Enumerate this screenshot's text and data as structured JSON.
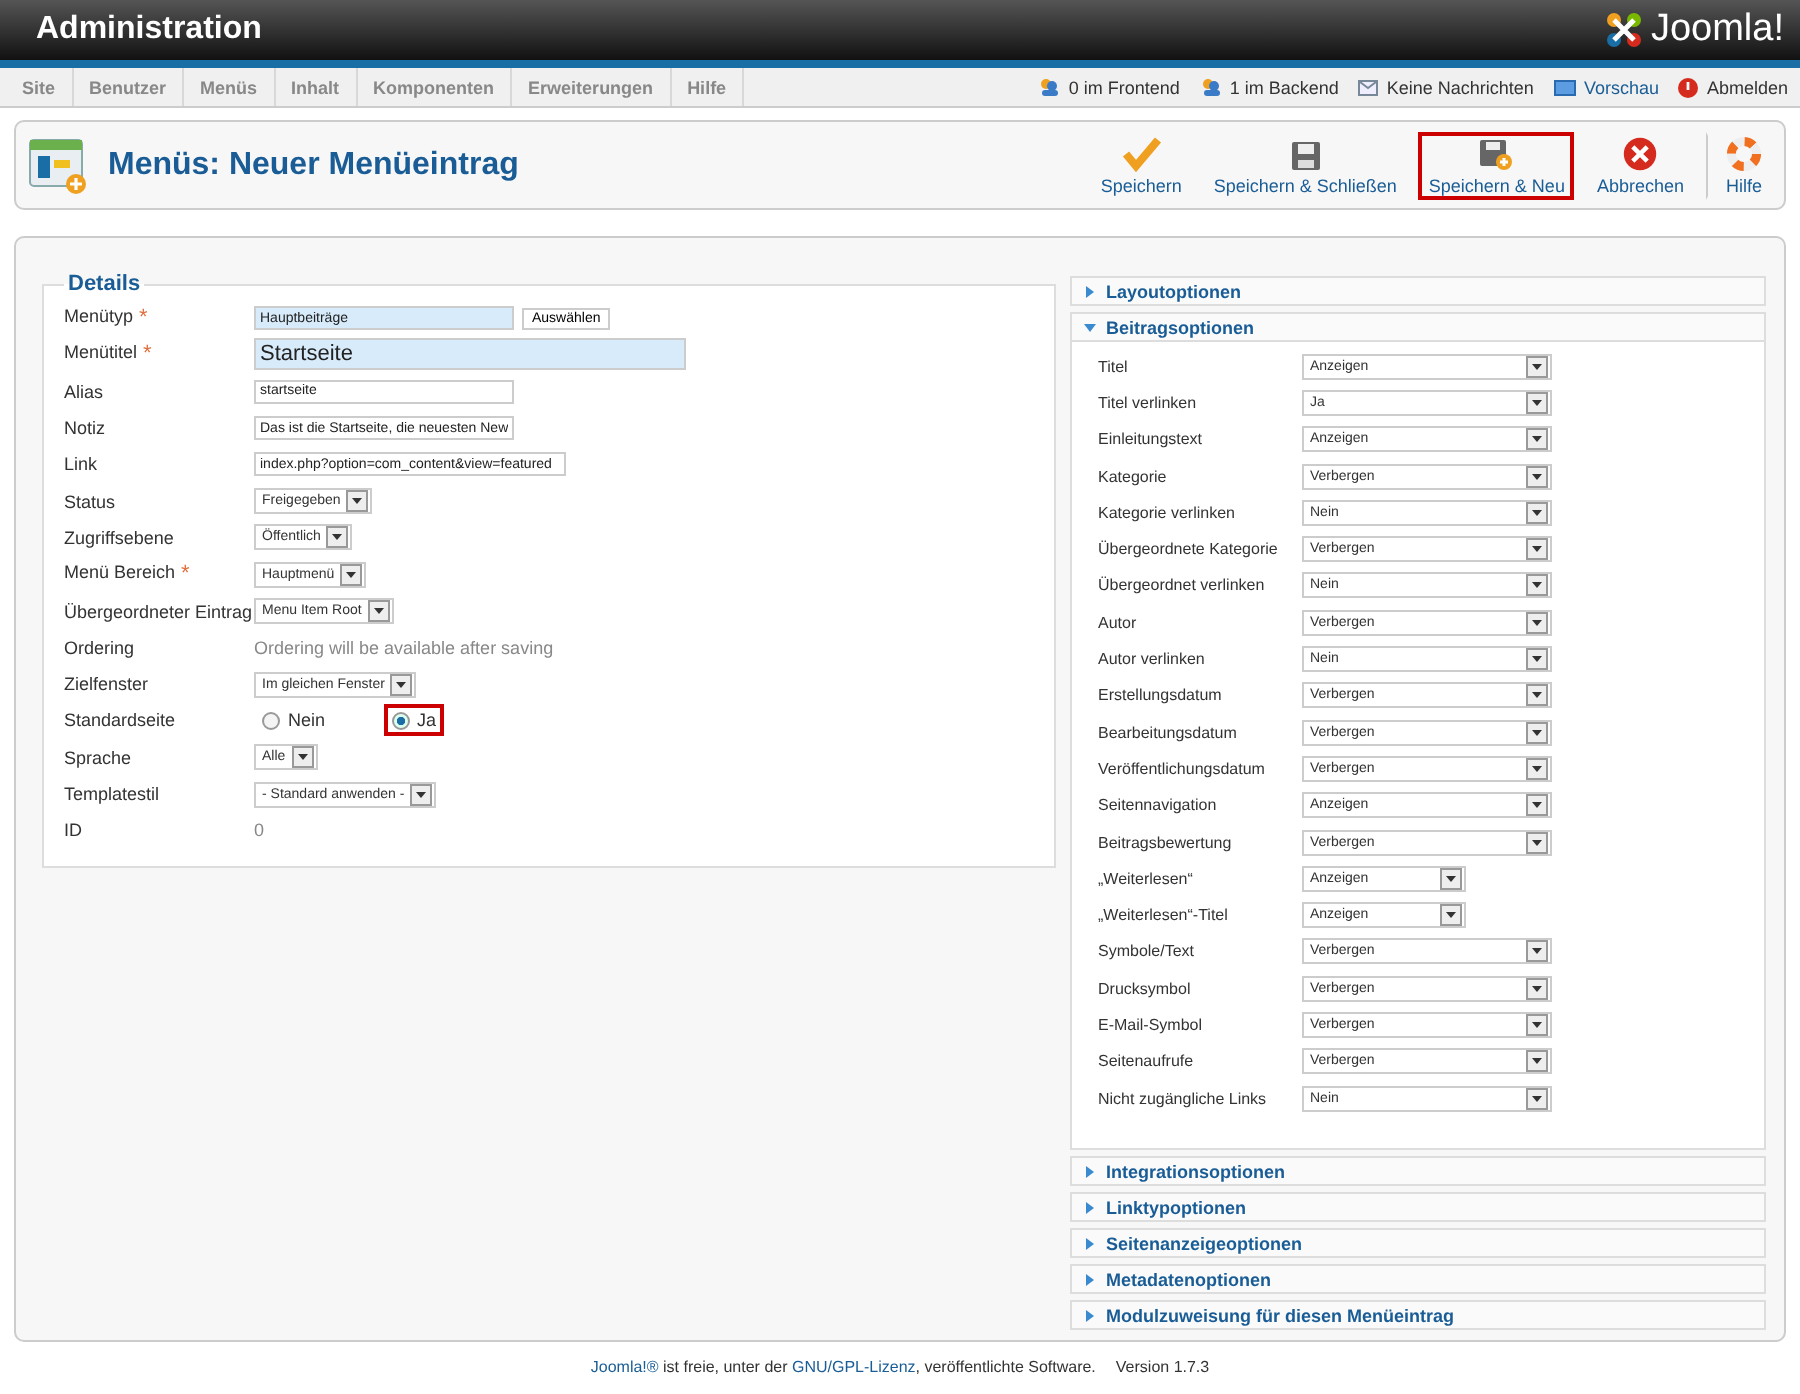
{
  "header": {
    "title": "Administration",
    "logo": "Joomla!"
  },
  "menu": [
    {
      "label": "Site"
    },
    {
      "label": "Benutzer"
    },
    {
      "label": "Menüs"
    },
    {
      "label": "Inhalt"
    },
    {
      "label": "Komponenten"
    },
    {
      "label": "Erweiterungen"
    },
    {
      "label": "Hilfe"
    }
  ],
  "status": [
    {
      "kind": "users",
      "label": "0 im Frontend"
    },
    {
      "kind": "users",
      "label": "1 im Backend"
    },
    {
      "kind": "mail",
      "label": "Keine Nachrichten"
    },
    {
      "kind": "preview",
      "label": "Vorschau"
    },
    {
      "kind": "logout",
      "label": "Abmelden"
    }
  ],
  "page_title": "Menüs: Neuer Menüeintrag",
  "toolbar": [
    {
      "kind": "save",
      "label": "Speichern",
      "highlighted": false
    },
    {
      "kind": "save-close",
      "label": "Speichern & Schließen",
      "highlighted": false
    },
    {
      "kind": "save-new",
      "label": "Speichern & Neu",
      "highlighted": true
    },
    {
      "kind": "cancel",
      "label": "Abbrechen",
      "highlighted": false
    },
    {
      "kind": "help",
      "label": "Hilfe",
      "highlighted": false
    }
  ],
  "details": {
    "legend": "Details",
    "fields": [
      {
        "kind": "picker",
        "label": "Menütyp",
        "required_mark": "*",
        "value": "Hauptbeiträge",
        "button": "Auswählen"
      },
      {
        "kind": "title",
        "label": "Menütitel",
        "required_mark": "*",
        "value": "Startseite"
      },
      {
        "kind": "text",
        "label": "Alias",
        "value": "startseite"
      },
      {
        "kind": "text",
        "label": "Notiz",
        "value": "Das ist die Startseite, die neuesten New"
      },
      {
        "kind": "text",
        "label": "Link",
        "value": "index.php?option=com_content&view=featured"
      },
      {
        "kind": "select",
        "label": "Status",
        "value": "Freigegeben"
      },
      {
        "kind": "select",
        "label": "Zugriffsebene",
        "value": "Öffentlich"
      },
      {
        "kind": "select",
        "label": "Menü Bereich",
        "required_mark": "*",
        "value": "Hauptmenü"
      },
      {
        "kind": "select",
        "label": "Übergeordneter Eintrag",
        "value": "Menu Item Root"
      },
      {
        "kind": "static",
        "label": "Ordering",
        "value": "Ordering will be available after saving"
      },
      {
        "kind": "select",
        "label": "Zielfenster",
        "value": "Im gleichen Fenster"
      },
      {
        "kind": "radio",
        "label": "Standardseite",
        "options": [
          {
            "label": "Nein",
            "selected": false,
            "highlighted": false
          },
          {
            "label": "Ja",
            "selected": true,
            "highlighted": true
          }
        ]
      },
      {
        "kind": "select",
        "label": "Sprache",
        "value": "Alle"
      },
      {
        "kind": "select",
        "label": "Templatestil",
        "value": "- Standard anwenden -"
      },
      {
        "kind": "static",
        "label": "ID",
        "value": "0"
      }
    ]
  },
  "panels": [
    {
      "title": "Layoutoptionen",
      "expanded": false
    },
    {
      "title": "Beitragsoptionen",
      "expanded": true,
      "options": [
        {
          "label": "Titel",
          "value": "Anzeigen"
        },
        {
          "label": "Titel verlinken",
          "value": "Ja"
        },
        {
          "label": "Einleitungstext",
          "value": "Anzeigen"
        },
        {
          "label": "Kategorie",
          "value": "Verbergen"
        },
        {
          "label": "Kategorie verlinken",
          "value": "Nein"
        },
        {
          "label": "Übergeordnete Kategorie",
          "value": "Verbergen"
        },
        {
          "label": "Übergeordnet verlinken",
          "value": "Nein"
        },
        {
          "label": "Autor",
          "value": "Verbergen"
        },
        {
          "label": "Autor verlinken",
          "value": "Nein"
        },
        {
          "label": "Erstellungsdatum",
          "value": "Verbergen"
        },
        {
          "label": "Bearbeitungsdatum",
          "value": "Verbergen"
        },
        {
          "label": "Veröffentlichungsdatum",
          "value": "Verbergen"
        },
        {
          "label": "Seitennavigation",
          "value": "Anzeigen"
        },
        {
          "label": "Beitragsbewertung",
          "value": "Verbergen"
        },
        {
          "label": "„Weiterlesen“",
          "value": "Anzeigen"
        },
        {
          "label": "„Weiterlesen“-Titel",
          "value": "Anzeigen"
        },
        {
          "label": "Symbole/Text",
          "value": "Verbergen"
        },
        {
          "label": "Drucksymbol",
          "value": "Verbergen"
        },
        {
          "label": "E-Mail-Symbol",
          "value": "Verbergen"
        },
        {
          "label": "Seitenaufrufe",
          "value": "Verbergen"
        },
        {
          "label": "Nicht zugängliche Links",
          "value": "Nein"
        }
      ]
    },
    {
      "title": "Integrationsoptionen",
      "expanded": false
    },
    {
      "title": "Linktypoptionen",
      "expanded": false
    },
    {
      "title": "Seitenanzeigeoptionen",
      "expanded": false
    },
    {
      "title": "Metadatenoptionen",
      "expanded": false
    },
    {
      "title": "Modulzuweisung für diesen Menüeintrag",
      "expanded": false
    }
  ],
  "footer": {
    "brand": "Joomla!®",
    "text1": " ist freie, unter der ",
    "license": "GNU/GPL-Lizenz",
    "text2": ", veröffentlichte Software.",
    "version": "Version 1.7.3"
  }
}
